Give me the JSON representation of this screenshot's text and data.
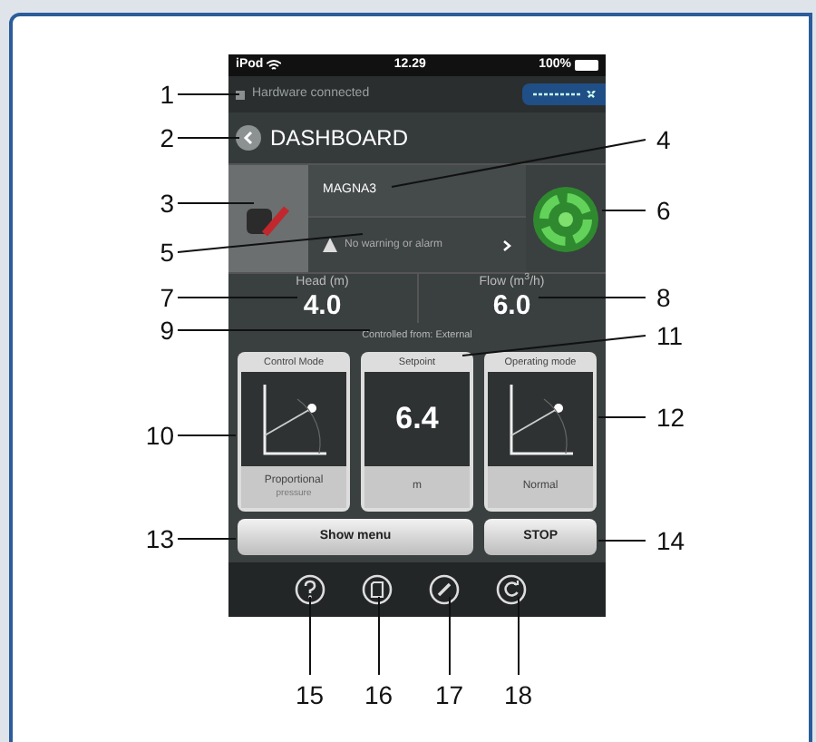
{
  "status_bar": {
    "carrier": "iPod",
    "time": "12.29",
    "battery": "100%"
  },
  "connection": {
    "label": "Hardware connected",
    "connected": true
  },
  "header": {
    "title": "DASHBOARD"
  },
  "product": {
    "name": "MAGNA3",
    "alarm": "No warning or alarm"
  },
  "readings": [
    {
      "label": "Head (m)",
      "value": "4.0"
    },
    {
      "label": "Flow (m$^{3}$/h)",
      "value": "6.0"
    }
  ],
  "controlled_from": "Controlled from: External",
  "tiles": [
    {
      "kind": "graph",
      "title": "Control Mode",
      "label": "Proportional",
      "sublabel": "pressure"
    },
    {
      "kind": "value",
      "title": "Setpoint",
      "value": "6.4",
      "label": "m"
    },
    {
      "kind": "graph",
      "title": "Operating mode",
      "label": "Normal"
    }
  ],
  "buttons": [
    {
      "label": "Show menu"
    },
    {
      "label": "STOP"
    }
  ],
  "callouts": [
    "1",
    "2",
    "3",
    "4",
    "5",
    "6",
    "7",
    "8",
    "9",
    "10",
    "11",
    "12",
    "13",
    "14",
    "15",
    "16",
    "17",
    "18"
  ]
}
